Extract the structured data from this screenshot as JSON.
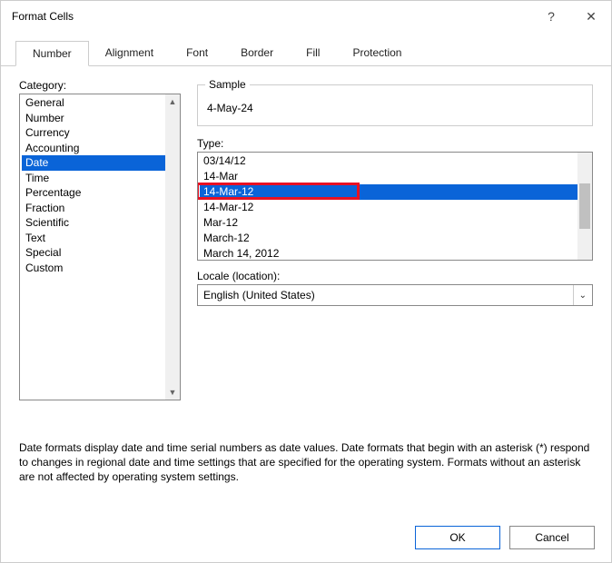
{
  "window": {
    "title": "Format Cells",
    "help_glyph": "?",
    "close_glyph": "✕"
  },
  "tabs": {
    "items": [
      {
        "label": "Number",
        "active": true
      },
      {
        "label": "Alignment",
        "active": false
      },
      {
        "label": "Font",
        "active": false
      },
      {
        "label": "Border",
        "active": false
      },
      {
        "label": "Fill",
        "active": false
      },
      {
        "label": "Protection",
        "active": false
      }
    ]
  },
  "category": {
    "label": "Category:",
    "items": [
      "General",
      "Number",
      "Currency",
      "Accounting",
      "Date",
      "Time",
      "Percentage",
      "Fraction",
      "Scientific",
      "Text",
      "Special",
      "Custom"
    ],
    "selected_index": 4
  },
  "sample": {
    "legend": "Sample",
    "value": "4-May-24"
  },
  "type": {
    "label": "Type:",
    "items": [
      "03/14/12",
      "14-Mar",
      "14-Mar-12",
      "14-Mar-12",
      "Mar-12",
      "March-12",
      "March 14, 2012"
    ],
    "selected_index": 2,
    "highlight_index": 2
  },
  "locale": {
    "label": "Locale (location):",
    "value": "English (United States)"
  },
  "description": "Date formats display date and time serial numbers as date values.  Date formats that begin with an asterisk (*) respond to changes in regional date and time settings that are specified for the operating system. Formats without an asterisk are not affected by operating system settings.",
  "buttons": {
    "ok": "OK",
    "cancel": "Cancel"
  },
  "scroll": {
    "up_glyph": "▲",
    "down_glyph": "▼"
  }
}
